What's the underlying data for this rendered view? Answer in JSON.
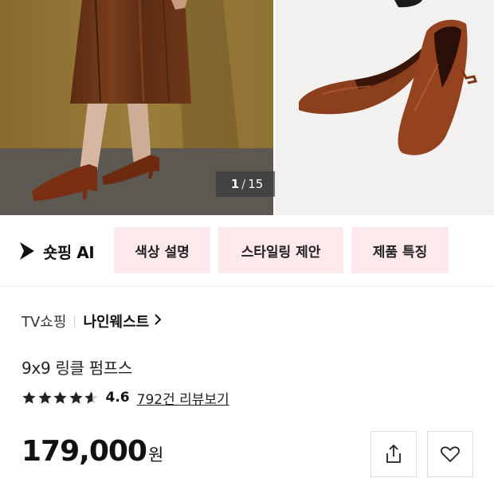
{
  "gallery": {
    "current": "1",
    "separator": "/",
    "total": "15"
  },
  "ai": {
    "logo_label": "숏핑 AI",
    "chips": [
      "색상 설명",
      "스타일링 제안",
      "제품 특징"
    ]
  },
  "product": {
    "category": "TV쇼핑",
    "brand": "나인웨스트",
    "title": "9x9 링클 펌프스",
    "rating_value": "4.6",
    "rating_stars": 4.6,
    "reviews_label": "792건 리뷰보기",
    "price": "179,000",
    "currency": "원"
  },
  "icons": {
    "share": "share-icon",
    "wishlist": "heart-outline-icon",
    "chevron": "chevron-right-icon",
    "ai_logo": "play-triangle-icon"
  },
  "colors": {
    "chip_bg": "#fde8ec",
    "text": "#111111",
    "counter_bg": "#3c3c3c",
    "leather": "#8a4221"
  }
}
